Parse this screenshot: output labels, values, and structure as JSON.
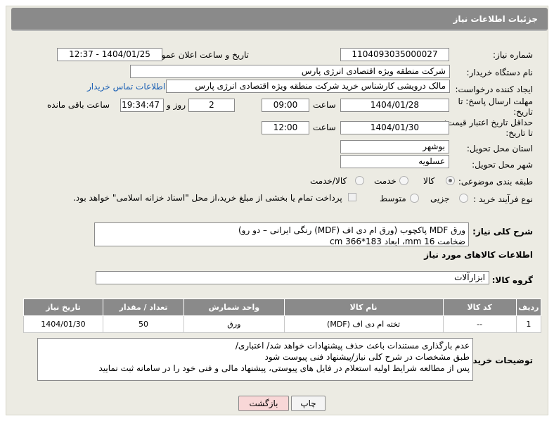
{
  "header": {
    "title": "جزئیات اطلاعات نیاز"
  },
  "fields": {
    "need_number_label": "شماره نیاز:",
    "need_number": "1104093035000027",
    "announce_label": "تاریخ و ساعت اعلان عمومی:",
    "announce_value": "1404/01/25 - 12:37",
    "buyer_org_label": "نام دستگاه خریدار:",
    "buyer_org": "شرکت منطقه ویژه اقتصادی انرژی پارس",
    "requester_label": "ایجاد کننده درخواست:",
    "requester": "مالک  درویشی کارشناس خرید شرکت منطقه ویژه اقتصادی انرژی پارس",
    "contact_link": "اطلاعات تماس خریدار",
    "deadline_label": "مهلت ارسال پاسخ: تا تاریخ:",
    "deadline_date": "1404/01/28",
    "time_label": "ساعت",
    "deadline_time": "09:00",
    "days_value": "2",
    "days_label": "روز و",
    "remaining_time": "19:34:47",
    "remaining_label": "ساعت باقی مانده",
    "validity_label": "حداقل تاریخ اعتبار قیمت: تا تاریخ:",
    "validity_date": "1404/01/30",
    "validity_time": "12:00",
    "province_label": "استان محل تحویل:",
    "province": "بوشهر",
    "city_label": "شهر محل تحویل:",
    "city": "عسلویه",
    "category_label": "طبقه بندی موضوعی:",
    "category_options": [
      "کالا",
      "خدمت",
      "کالا/خدمت"
    ],
    "category_selected": "کالا",
    "process_label": "نوع فرآیند خرید :",
    "process_options": [
      "جزیی",
      "متوسط"
    ],
    "process_note": "پرداخت تمام یا بخشی از مبلغ خرید،از محل \"اسناد خزانه اسلامی\" خواهد بود."
  },
  "summary": {
    "label": "شرح کلی نیاز:",
    "line1": "ورق MDF پاکچوب (ورق ام دی اف (MDF) رنگی ایرانی – دو رو)",
    "line2": "ضخامت 16 mm، ابعاد 183*366 cm"
  },
  "goods_section_title": "اطلاعات کالاهای مورد نیاز",
  "goods_group": {
    "label": "گروه کالا:",
    "value": "ابزارآلات"
  },
  "table": {
    "headers": [
      "ردیف",
      "کد کالا",
      "نام کالا",
      "واحد شمارش",
      "تعداد / مقدار",
      "تاریخ نیاز"
    ],
    "rows": [
      [
        "1",
        "--",
        "تخته ام دی اف (MDF)",
        "ورق",
        "50",
        "1404/01/30"
      ]
    ]
  },
  "buyer_notes": {
    "label": "توضیحات خریدار:",
    "line1": "عدم بارگذاری مستندات باعث حذف پیشنهادات خواهد شد/ اعتباری/",
    "line2": "طبق مشخصات در شرح کلی نیاز/پیشنهاد فنی پیوست شود",
    "line3": "پس از مطالعه شرایط اولیه استعلام در فایل های پیوستی، پیشنهاد مالی و فنی خود را در سامانه ثبت نمایید"
  },
  "buttons": {
    "print": "چاپ",
    "back": "بازگشت"
  },
  "colors": {
    "header_bg": "#8a8a8a",
    "panel_bg": "#ecebe3",
    "link": "#1a5fb4",
    "back_button": "#f8d7d7"
  }
}
